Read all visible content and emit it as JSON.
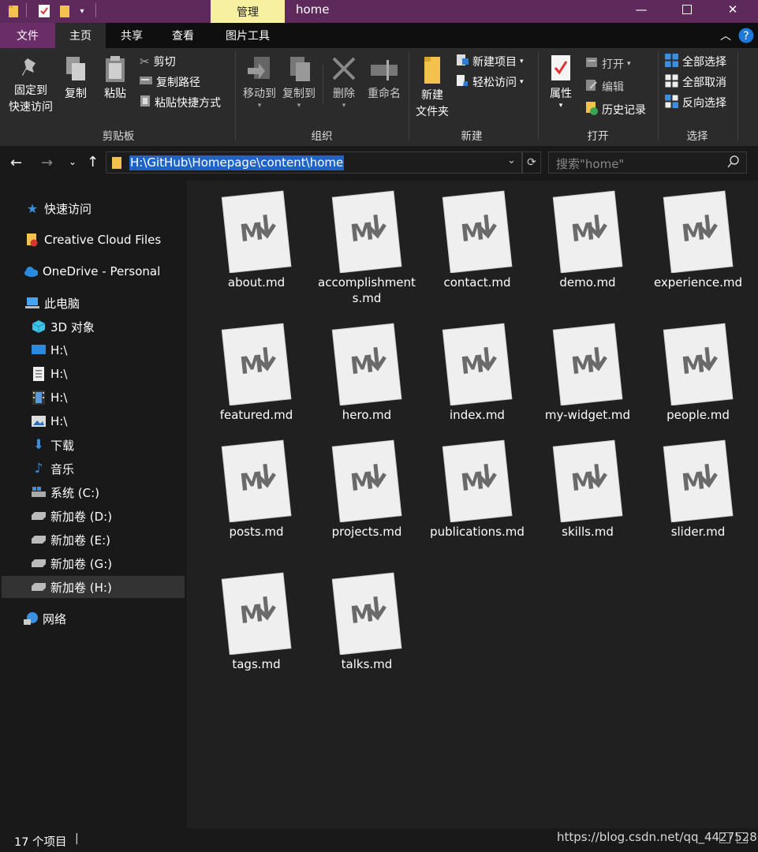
{
  "window": {
    "title": "home",
    "context_tab": "管理"
  },
  "ribbon_tabs": [
    {
      "label": "文件"
    },
    {
      "label": "主页"
    },
    {
      "label": "共享"
    },
    {
      "label": "查看"
    },
    {
      "label": "图片工具"
    }
  ],
  "clipboard": {
    "pin": "固定到\n快速访问",
    "copy": "复制",
    "paste": "粘贴",
    "cut": "剪切",
    "copy_path": "复制路径",
    "paste_shortcut": "粘贴快捷方式",
    "label": "剪贴板"
  },
  "organize": {
    "move_to": "移动到",
    "copy_to": "复制到",
    "delete": "删除",
    "rename": "重命名",
    "label": "组织"
  },
  "new_group": {
    "new_folder": "新建\n文件夹",
    "new_item": "新建项目",
    "easy_access": "轻松访问",
    "label": "新建"
  },
  "open_group": {
    "properties": "属性",
    "open": "打开",
    "edit": "编辑",
    "history": "历史记录",
    "label": "打开"
  },
  "select_group": {
    "select_all": "全部选择",
    "select_none": "全部取消",
    "invert": "反向选择",
    "label": "选择"
  },
  "address": {
    "path": "H:\\GitHub\\Homepage\\content\\home",
    "search_placeholder": "搜索\"home\""
  },
  "sidebar": {
    "items": [
      {
        "label": "快速访问"
      },
      {
        "label": "Creative Cloud Files"
      },
      {
        "label": "OneDrive - Personal"
      },
      {
        "label": "此电脑"
      },
      {
        "label": "3D 对象"
      },
      {
        "label": "H:\\"
      },
      {
        "label": "H:\\"
      },
      {
        "label": "H:\\"
      },
      {
        "label": "H:\\"
      },
      {
        "label": "下载"
      },
      {
        "label": "音乐"
      },
      {
        "label": "系统 (C:)"
      },
      {
        "label": "新加卷 (D:)"
      },
      {
        "label": "新加卷 (E:)"
      },
      {
        "label": "新加卷 (G:)"
      },
      {
        "label": "新加卷 (H:)"
      },
      {
        "label": "网络"
      }
    ]
  },
  "files": [
    {
      "name": "about.md"
    },
    {
      "name": "accomplishments.md"
    },
    {
      "name": "contact.md"
    },
    {
      "name": "demo.md"
    },
    {
      "name": "experience.md"
    },
    {
      "name": "featured.md"
    },
    {
      "name": "hero.md"
    },
    {
      "name": "index.md"
    },
    {
      "name": "my-widget.md"
    },
    {
      "name": "people.md"
    },
    {
      "name": "posts.md"
    },
    {
      "name": "projects.md"
    },
    {
      "name": "publications.md"
    },
    {
      "name": "skills.md"
    },
    {
      "name": "slider.md"
    },
    {
      "name": "tags.md"
    },
    {
      "name": "talks.md"
    }
  ],
  "status": {
    "count": "17 个项目",
    "separator": "|",
    "watermark": "https://blog.csdn.net/qq_44275286"
  },
  "colors": {
    "titlebar": "#5e2a5c",
    "accent": "#1e64c8",
    "manage_tab": "#f6f0a0"
  }
}
